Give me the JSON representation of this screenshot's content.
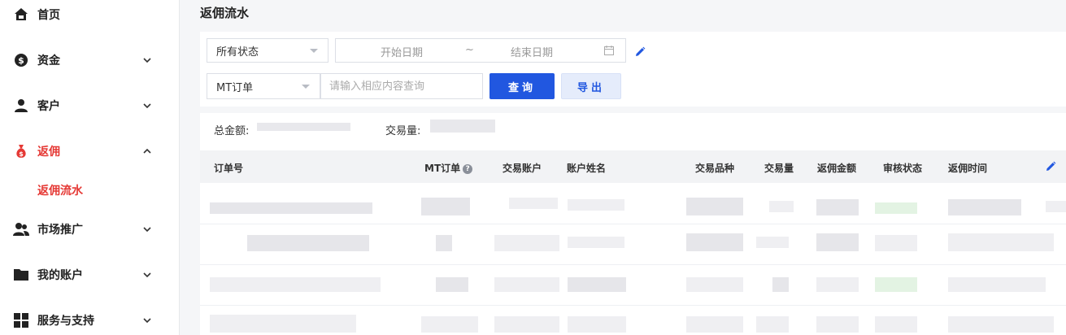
{
  "sidebar": {
    "items": [
      {
        "label": "首页",
        "icon": "home-icon"
      },
      {
        "label": "资金",
        "icon": "dollar-icon"
      },
      {
        "label": "客户",
        "icon": "user-icon"
      },
      {
        "label": "返佣",
        "icon": "money-bag-icon"
      },
      {
        "label": "市场推广",
        "icon": "users-icon"
      },
      {
        "label": "我的账户",
        "icon": "folder-icon"
      },
      {
        "label": "服务与支持",
        "icon": "grid-icon"
      }
    ],
    "active_sub_label": "返佣流水"
  },
  "page": {
    "title": "返佣流水"
  },
  "filters": {
    "status_select": "所有状态",
    "date_start_placeholder": "开始日期",
    "date_separator": "~",
    "date_end_placeholder": "结束日期",
    "order_type_select": "MT订单",
    "search_placeholder": "请输入相应内容查询",
    "query_button": "查询",
    "export_button": "导出"
  },
  "summary": {
    "total_amount_label": "总金额:",
    "volume_label": "交易量:"
  },
  "table": {
    "columns": [
      "订单号",
      "MT订单",
      "交易账户",
      "账户姓名",
      "交易品种",
      "交易量",
      "返佣金额",
      "审核状态",
      "返佣时间"
    ]
  },
  "colors": {
    "accent": "#2157e0",
    "active": "#e53935"
  }
}
